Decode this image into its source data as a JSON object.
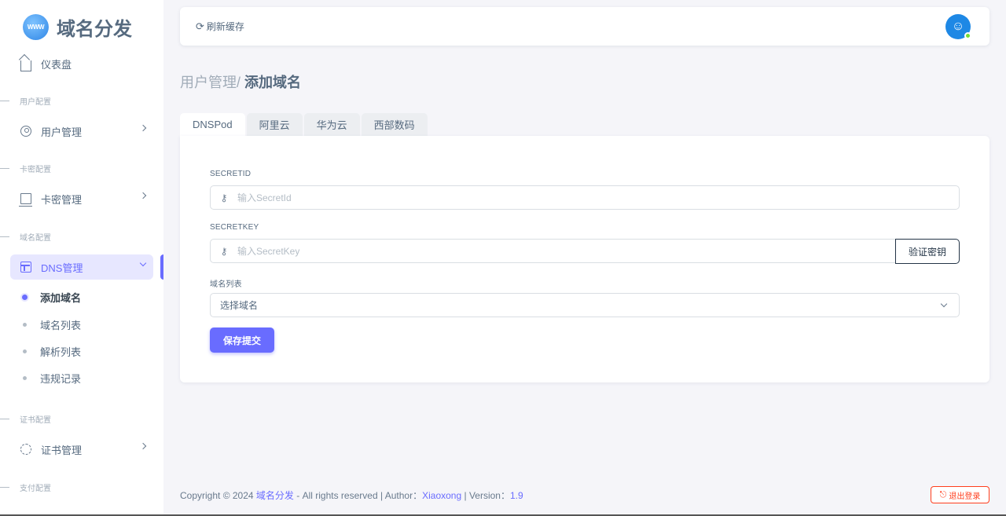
{
  "brand": {
    "logo_text": "WWW",
    "title": "域名分发"
  },
  "sidebar": {
    "dashboard": "仪表盘",
    "headers": [
      "用户配置",
      "卡密配置",
      "域名配置",
      "证书配置",
      "支付配置"
    ],
    "user_mgmt": "用户管理",
    "card_mgmt": "卡密管理",
    "dns_mgmt": "DNS管理",
    "dns_sub": [
      "添加域名",
      "域名列表",
      "解析列表",
      "违规记录"
    ],
    "cert_mgmt": "证书管理"
  },
  "navbar": {
    "refresh_label": "刷新缓存",
    "refresh_icon": "⟳",
    "avatar_glyph": "☺"
  },
  "breadcrumb": {
    "parent": "用户管理/",
    "current": "添加域名"
  },
  "tabs": [
    "DNSPod",
    "阿里云",
    "华为云",
    "西部数码"
  ],
  "form": {
    "secretid_label": "SECRETID",
    "secretid_placeholder": "输入SecretId",
    "secretkey_label": "SECRETKEY",
    "secretkey_placeholder": "输入SecretKey",
    "verify_button": "验证密钥",
    "domain_list_label": "域名列表",
    "domain_select_value": "选择域名",
    "submit_button": "保存提交",
    "key_icon": "⚷"
  },
  "footer": {
    "prefix": "Copyright © 2024 ",
    "site": "域名分发",
    "middle": " - All rights reserved | Author：",
    "author": "Xiaoxong",
    "version_label": " | Version：",
    "version": "1.9"
  },
  "logout": {
    "label": "退出登录",
    "icon": "⎋"
  },
  "colors": {
    "primary": "#696cff",
    "danger": "#ff3e1d",
    "online": "#71dd37"
  }
}
